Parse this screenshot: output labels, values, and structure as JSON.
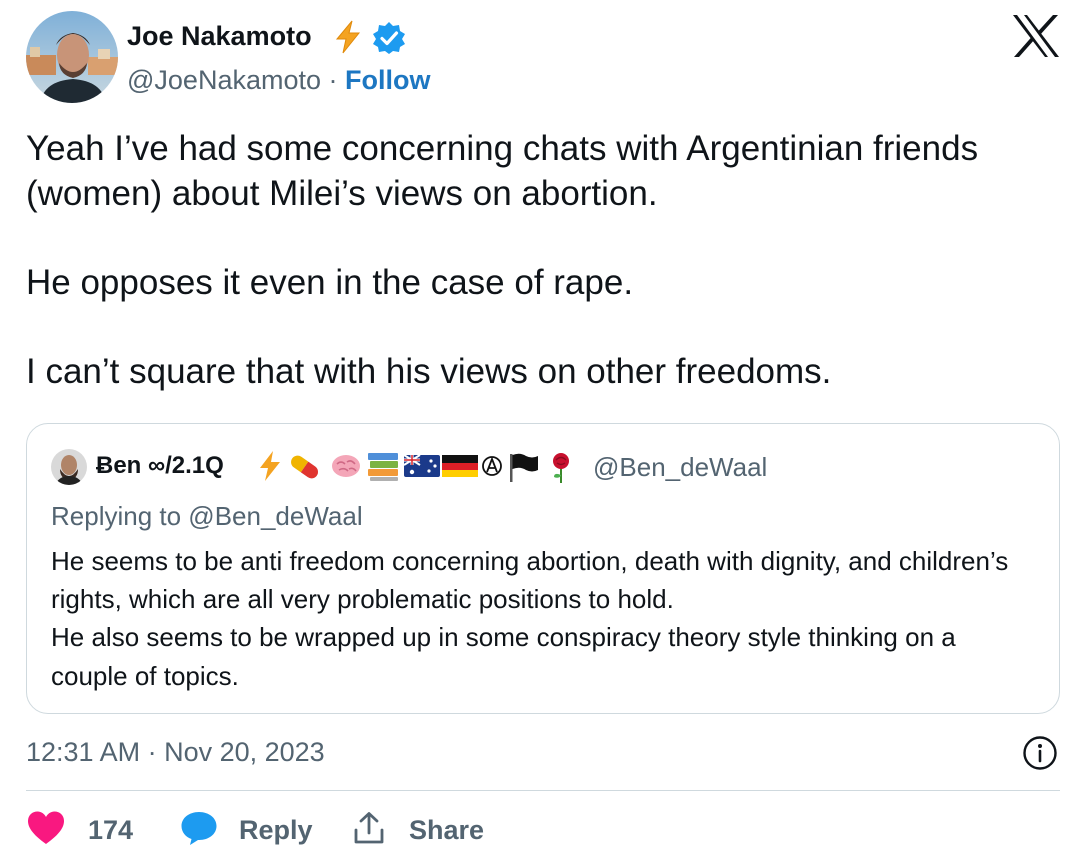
{
  "author": {
    "name": "Joe Nakamoto",
    "handle": "@JoeNakamoto",
    "separator": " · ",
    "follow_label": "Follow",
    "icons": [
      "lightning-icon",
      "verified-badge-icon"
    ]
  },
  "platform_logo": "x-logo-icon",
  "tweet_text": "Yeah I’ve had some concerning chats with Argentinian friends (women) about Milei’s views on abortion.\n\nHe opposes it even in the case of rape.\n\nI can’t square that with his views on other freedoms.",
  "quoted_tweet": {
    "name": "Ƀen ∞/2.1Q",
    "emoji_icons": [
      "lightning-icon",
      "pill-icon",
      "brain-icon",
      "books-icon",
      "australia-flag-icon",
      "germany-flag-icon",
      "anarchy-icon",
      "black-flag-icon",
      "rose-icon"
    ],
    "handle": "@Ben_deWaal",
    "replying_to": "Replying to @Ben_deWaal",
    "text": "He seems to be anti freedom concerning abortion, death with dignity, and children’s rights, which are all very problematic positions to hold.\nHe also seems to be wrapped up in some conspiracy theory style thinking on a couple of topics."
  },
  "timestamp": "12:31 AM · Nov 20, 2023",
  "actions": {
    "like_count": "174",
    "reply_label": "Reply",
    "share_label": "Share"
  },
  "colors": {
    "accent": "#1d9bf0",
    "follow": "#1d77c2",
    "like": "#f91880",
    "secondary_text": "#536471",
    "border": "#cfd9de"
  }
}
